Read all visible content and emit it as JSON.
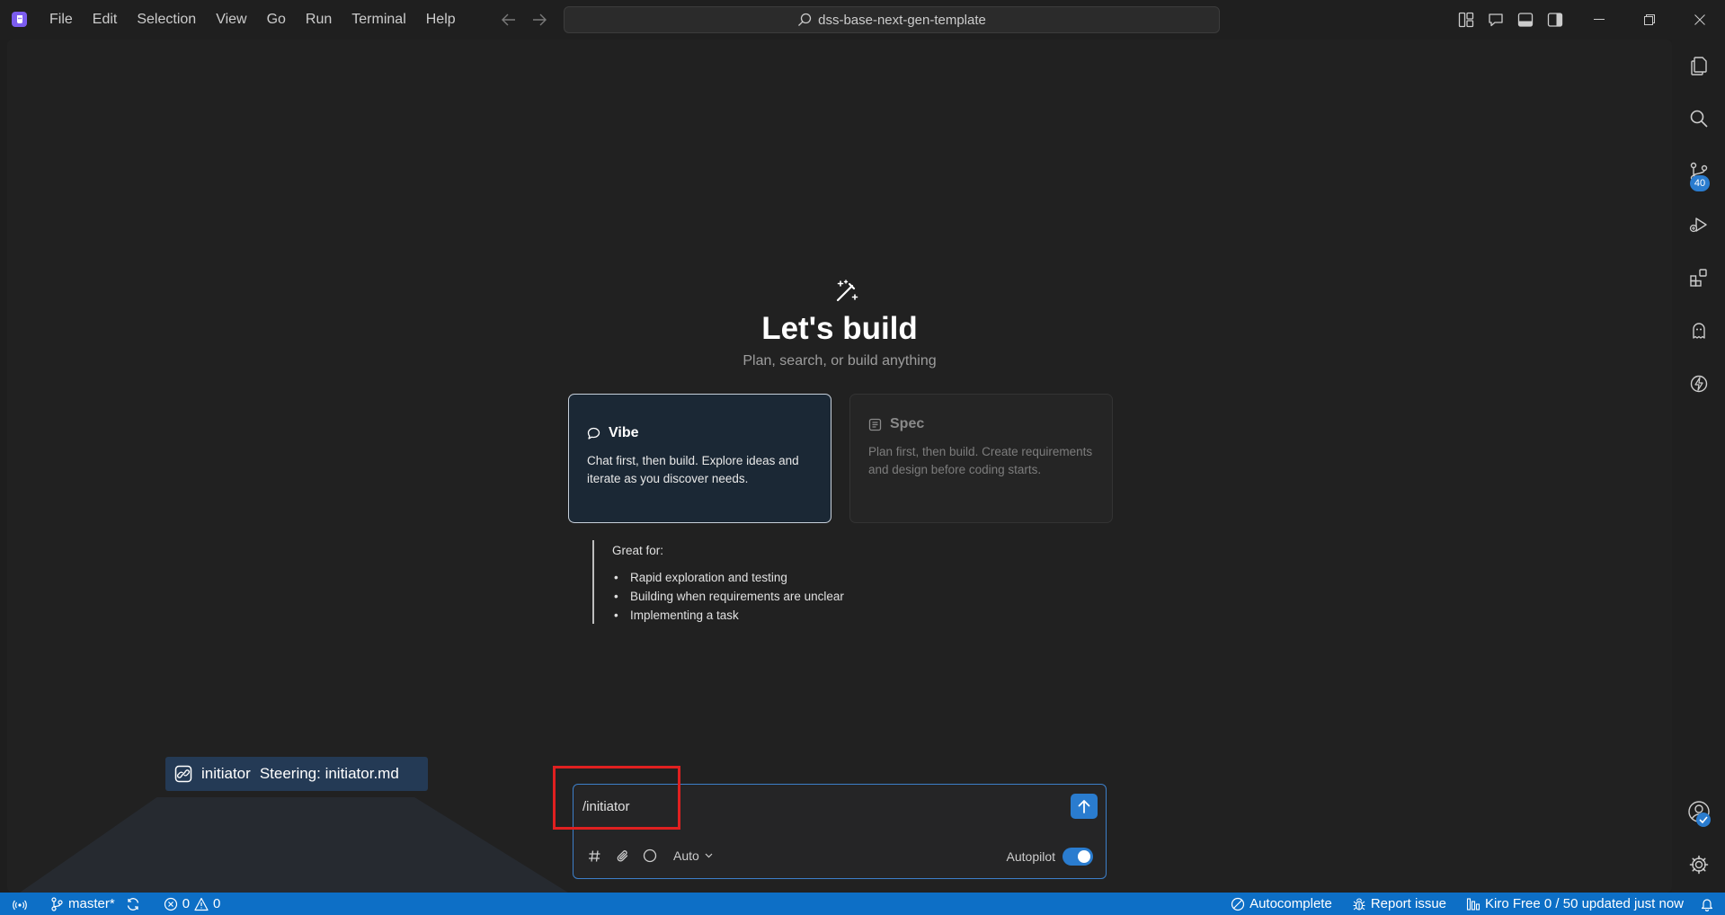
{
  "menu": [
    "File",
    "Edit",
    "Selection",
    "View",
    "Go",
    "Run",
    "Terminal",
    "Help"
  ],
  "command_center": {
    "label": "dss-base-next-gen-template",
    "icon": "search-icon"
  },
  "hero": {
    "icon": "magic-wand-icon",
    "title": "Let's build",
    "subtitle": "Plan, search, or build anything"
  },
  "modes": {
    "vibe": {
      "title": "Vibe",
      "icon": "chat-bubble-icon",
      "description": "Chat first, then build. Explore ideas and iterate as you discover needs.",
      "selected": true
    },
    "spec": {
      "title": "Spec",
      "icon": "document-icon",
      "description": "Plan first, then build. Create requirements and design before coding starts.",
      "selected": false
    }
  },
  "great_for": {
    "title": "Great for:",
    "items": [
      "Rapid exploration and testing",
      "Building when requirements are unclear",
      "Implementing a task"
    ]
  },
  "suggestion": {
    "name": "initiator",
    "description": "Steering: initiator.md",
    "icon": "steering-icon"
  },
  "chat": {
    "input_value": "/initiator",
    "model": "Auto",
    "autopilot_label": "Autopilot",
    "autopilot_on": true
  },
  "activity_bar": {
    "source_control_badge": "40"
  },
  "status_bar": {
    "branch": "master*",
    "errors": "0",
    "warnings": "0",
    "autocomplete": "Autocomplete",
    "report_issue": "Report issue",
    "plan": "Kiro Free 0 / 50 updated just now"
  },
  "colors": {
    "accent": "#2a7ccf",
    "status_bar": "#0d6fc6",
    "highlight": "#e02020",
    "logo": "#7b5cf0"
  }
}
